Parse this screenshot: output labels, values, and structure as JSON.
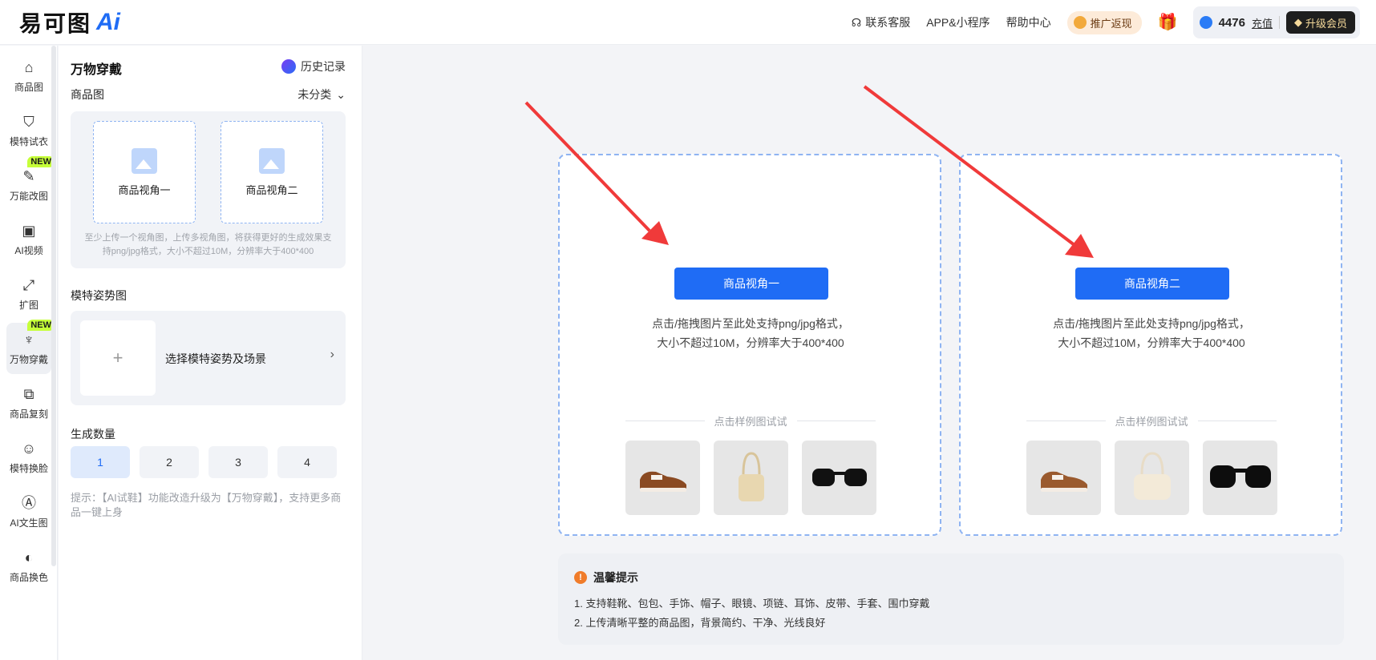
{
  "header": {
    "logo_text": "易可图",
    "logo_ai": "Ai",
    "nav": [
      "联系客服",
      "APP&小程序",
      "帮助中心"
    ],
    "promo": "推广返现",
    "points": "4476",
    "recharge": "充值",
    "upgrade": "升级会员"
  },
  "leftnav": {
    "items": [
      {
        "label": "商品图",
        "icon": "bag-icon",
        "glyph": "⌂"
      },
      {
        "label": "模特试衣",
        "icon": "shirt-icon",
        "glyph": "⛉"
      },
      {
        "label": "万能改图",
        "icon": "edit-image-icon",
        "glyph": "✎",
        "badge": "NEW"
      },
      {
        "label": "AI视频",
        "icon": "video-icon",
        "glyph": "▣"
      },
      {
        "label": "扩图",
        "icon": "expand-icon",
        "glyph": "⤢"
      },
      {
        "label": "万物穿戴",
        "icon": "necklace-icon",
        "glyph": "♆",
        "badge": "NEW"
      },
      {
        "label": "商品复刻",
        "icon": "copy-bag-icon",
        "glyph": "⧉"
      },
      {
        "label": "模特换脸",
        "icon": "face-icon",
        "glyph": "☺"
      },
      {
        "label": "AI文生图",
        "icon": "ai-text-icon",
        "glyph": "Ⓐ"
      },
      {
        "label": "商品换色",
        "icon": "color-drop-icon",
        "glyph": "◐"
      }
    ]
  },
  "panel": {
    "title": "万物穿戴",
    "history": "历史记录",
    "product_label": "商品图",
    "category": "未分类",
    "slot1": "商品视角一",
    "slot2": "商品视角二",
    "upload_hint": "至少上传一个视角图，上传多视角图，将获得更好的生成效果支持png/jpg格式，大小不超过10M，分辨率大于400*400",
    "pose_label": "模特姿势图",
    "pose_select": "选择模特姿势及场景",
    "count_label": "生成数量",
    "counts": [
      "1",
      "2",
      "3",
      "4"
    ],
    "selected_count": "1",
    "tip": "提示：【AI试鞋】功能改造升级为【万物穿戴】，支持更多商品一键上身"
  },
  "dropzones": [
    {
      "button": "商品视角一",
      "text_line1": "点击/拖拽图片至此处支持png/jpg格式，",
      "text_line2": "大小不超过10M，分辨率大于400*400",
      "sample_label": "点击样例图试试"
    },
    {
      "button": "商品视角二",
      "text_line1": "点击/拖拽图片至此处支持png/jpg格式，",
      "text_line2": "大小不超过10M，分辨率大于400*400",
      "sample_label": "点击样例图试试"
    }
  ],
  "notice": {
    "title": "温馨提示",
    "line1": "1. 支持鞋靴、包包、手饰、帽子、眼镜、项链、耳饰、皮带、手套、围巾穿戴",
    "line2": "2. 上传清晰平整的商品图，背景简约、干净、光线良好"
  },
  "colors": {
    "accent": "#1f6cf5",
    "annotation_arrow": "#f03a3a"
  }
}
